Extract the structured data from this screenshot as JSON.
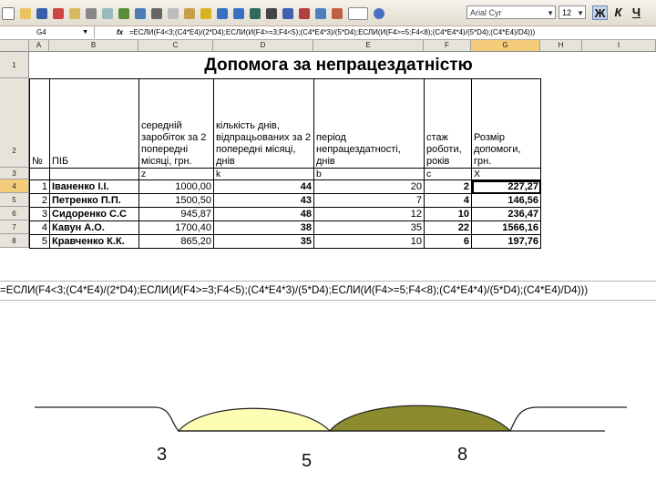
{
  "toolbar": {
    "font_name": "Arial Cyr",
    "font_size": "12",
    "bold_label": "Ж",
    "italic_label": "К",
    "underline_label": "Ч",
    "icons": [
      "new-icon",
      "open-icon",
      "save-icon",
      "permission-icon",
      "email-icon",
      "print-icon",
      "preview-icon",
      "spell-icon",
      "research-icon",
      "cut-icon",
      "copy-icon",
      "paste-icon",
      "format-painter-icon",
      "undo-icon",
      "redo-icon",
      "hyperlink-icon",
      "autosum-icon",
      "sort-asc-icon",
      "sort-desc-icon",
      "chart-icon",
      "drawing-icon",
      "zoom-icon",
      "help-icon"
    ],
    "colors": {
      "accent": "#6a86b8",
      "selected_header": "#f4cc7a"
    }
  },
  "formula_bar": {
    "cell_ref": "G4",
    "fx": "fx",
    "formula": "=ЕСЛИ(F4<3;(C4*E4)/(2*D4);ЕСЛИ(И(F4>=3;F4<5);(C4*E4*3)/(5*D4);ЕСЛИ(И(F4>=5;F4<8);(C4*E4*4)/(5*D4);(C4*E4)/D4)))"
  },
  "columns": [
    "A",
    "B",
    "C",
    "D",
    "E",
    "F",
    "G",
    "H",
    "I"
  ],
  "sheet": {
    "title": "Допомога за непрацездатністю",
    "row_numbers": [
      "1",
      "2",
      "3",
      "4",
      "5",
      "6",
      "7",
      "8"
    ],
    "headers": {
      "a": "№",
      "b": "ПІБ",
      "c": "середній заробіток за 2 попередні місяці, грн.",
      "d": "кількість днів, відпрацьованих за 2 попередні місяці, днів",
      "e": "період непрацездатності, днів",
      "f": "стаж роботи, років",
      "g": "Розмір допомоги, грн."
    },
    "vars": {
      "c": "z",
      "d": "k",
      "e": "b",
      "f": "c",
      "g": "X"
    },
    "rows": [
      {
        "n": "1",
        "name": "Іваненко І.І.",
        "salary": "1000,00",
        "days": "44",
        "period": "20",
        "exp": "2",
        "benefit": "227,27"
      },
      {
        "n": "2",
        "name": "Петренко П.П.",
        "salary": "1500,50",
        "days": "43",
        "period": "7",
        "exp": "4",
        "benefit": "146,56"
      },
      {
        "n": "3",
        "name": "Сидоренко С.С",
        "salary": "945,87",
        "days": "48",
        "period": "12",
        "exp": "10",
        "benefit": "236,47"
      },
      {
        "n": "4",
        "name": "Кавун А.О.",
        "salary": "1700,40",
        "days": "38",
        "period": "35",
        "exp": "22",
        "benefit": "1566,16"
      },
      {
        "n": "5",
        "name": "Кравченко К.К.",
        "salary": "865,20",
        "days": "35",
        "period": "10",
        "exp": "6",
        "benefit": "197,76"
      }
    ]
  },
  "formula_display": "=ЕСЛИ(F4<3;(C4*E4)/(2*D4);ЕСЛИ(И(F4>=3;F4<5);(C4*E4*3)/(5*D4);ЕСЛИ(И(F4>=5;F4<8);(C4*E4*4)/(5*D4);(C4*E4)/D4)))",
  "diagram": {
    "labels": [
      "3",
      "5",
      "8"
    ],
    "colors": {
      "left_arc": "#fdfdb4",
      "right_arc": "#8c8c2e"
    }
  }
}
